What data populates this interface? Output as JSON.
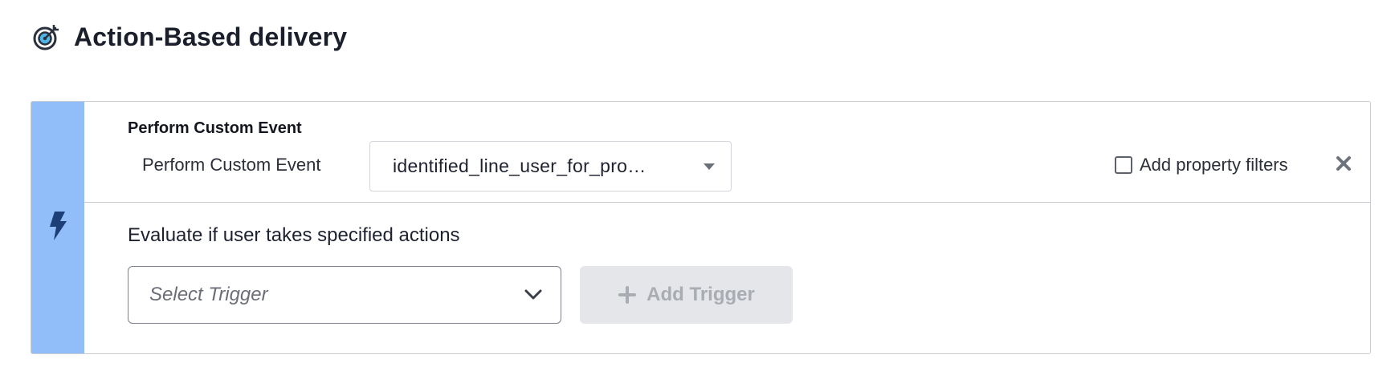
{
  "header": {
    "icon": "target-icon",
    "title": "Action-Based delivery"
  },
  "trigger_block": {
    "rail_icon": "lightning-bolt-icon",
    "section_label": "Perform Custom Event",
    "event_label": "Perform Custom Event",
    "event_select": {
      "value": "identified_line_user_for_pro…"
    },
    "property_filters": {
      "label": "Add property filters",
      "checked": false
    },
    "close_icon": "close-icon"
  },
  "evaluate": {
    "text": "Evaluate if user takes specified actions",
    "select_trigger_placeholder": "Select Trigger",
    "add_trigger_label": "Add Trigger"
  },
  "colors": {
    "rail": "#91bdf8",
    "title": "#1b1f2b",
    "disabled_bg": "#e5e6e9",
    "disabled_text": "#a9acb3"
  }
}
